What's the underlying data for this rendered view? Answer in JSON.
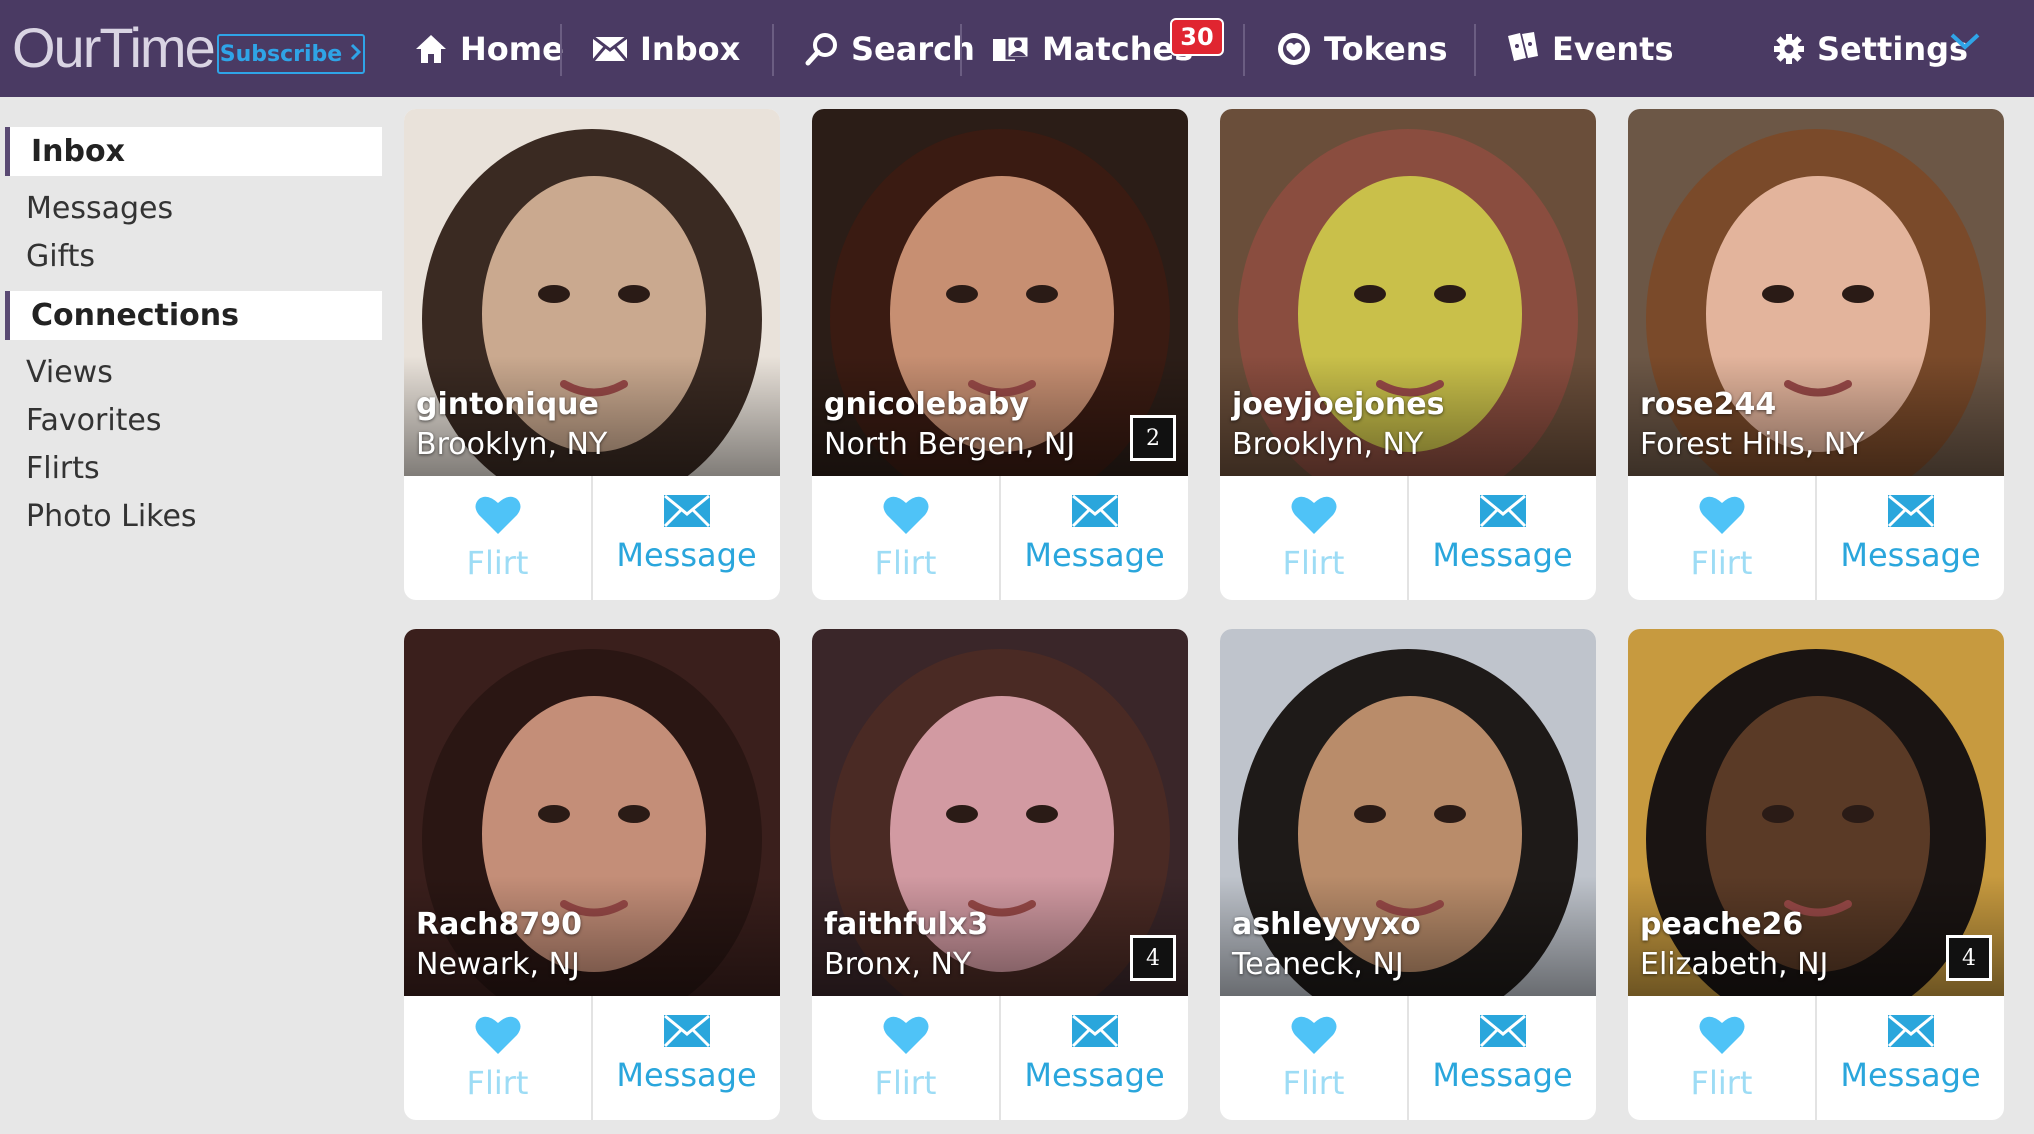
{
  "brand": {
    "logo": "OurTime",
    "subscribe": "Subscribe"
  },
  "nav": {
    "home": "Home",
    "inbox": "Inbox",
    "search": "Search",
    "matches": "Matches",
    "matches_badge": "30",
    "tokens": "Tokens",
    "events": "Events",
    "settings": "Settings"
  },
  "sidebar": {
    "inbox_header": "Inbox",
    "inbox_items": [
      "Messages",
      "Gifts"
    ],
    "connections_header": "Connections",
    "connection_items": [
      "Views",
      "Favorites",
      "Flirts",
      "Photo Likes"
    ]
  },
  "actions": {
    "flirt": "Flirt",
    "message": "Message"
  },
  "profiles": [
    {
      "username": "gintonique",
      "location": "Brooklyn, NY",
      "photo_count": "",
      "palette": [
        "#e9e2da",
        "#caa98f",
        "#3a2a22"
      ]
    },
    {
      "username": "gnicolebaby",
      "location": "North Bergen, NJ",
      "photo_count": "2",
      "palette": [
        "#2b1d17",
        "#c78f72",
        "#3a1b12"
      ]
    },
    {
      "username": "joeyjoejones",
      "location": "Brooklyn, NY",
      "photo_count": "",
      "palette": [
        "#6a4e3a",
        "#c9c04a",
        "#8a4d3f"
      ]
    },
    {
      "username": "rose244",
      "location": "Forest Hills, NY",
      "photo_count": "",
      "palette": [
        "#6c5746",
        "#e3b49c",
        "#7a4a2a"
      ]
    },
    {
      "username": "Rach8790",
      "location": "Newark, NJ",
      "photo_count": "",
      "palette": [
        "#3a1f1c",
        "#c48e78",
        "#2a1613"
      ]
    },
    {
      "username": "faithfulx3",
      "location": "Bronx, NY",
      "photo_count": "4",
      "palette": [
        "#3a2629",
        "#d29aa2",
        "#4a2a24"
      ]
    },
    {
      "username": "ashleyyyxo",
      "location": "Teaneck, NJ",
      "photo_count": "",
      "palette": [
        "#bfc4cc",
        "#b98c6a",
        "#1e1a18"
      ]
    },
    {
      "username": "peache26",
      "location": "Elizabeth, NJ",
      "photo_count": "4",
      "palette": [
        "#c79a3f",
        "#5a3a26",
        "#1a1412"
      ]
    }
  ],
  "colors": {
    "nav_bg": "#4a3a63",
    "accent": "#2aa6dc",
    "flirt": "#9ddcf5",
    "badge": "#e02530"
  }
}
